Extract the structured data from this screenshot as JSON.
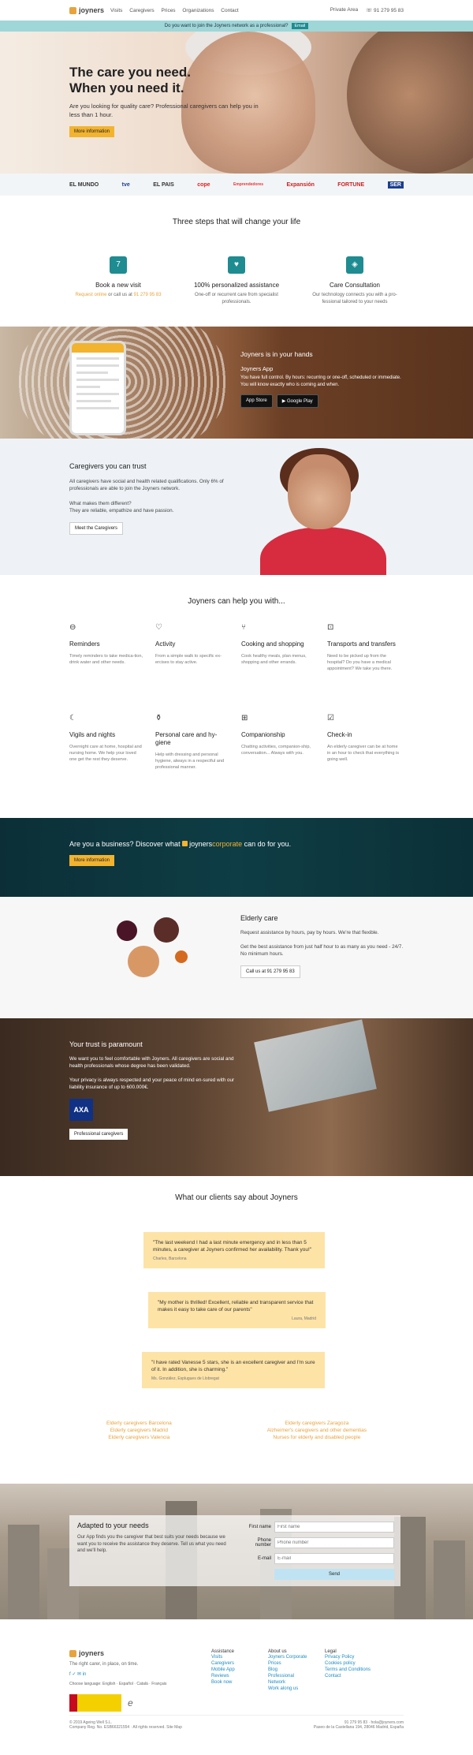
{
  "header": {
    "brand": "joyners",
    "nav": [
      "Visits",
      "Caregivers",
      "Prices",
      "Organizations",
      "Contact"
    ],
    "private": "Private Area",
    "phone": "91 279 95 83"
  },
  "banner": {
    "text": "Do you want to join the Joyners network as a professional?",
    "email": "Email"
  },
  "hero": {
    "title1": "The care you need.",
    "title2": "When you need it.",
    "subtitle": "Are you looking for quality care? Professional caregivers can help you in less than 1 hour.",
    "cta": "More information"
  },
  "press": [
    "EL MUNDO",
    "tve",
    "EL PAIS",
    "cope",
    "Emprendedores",
    "Expansión",
    "FORTUNE",
    "SER"
  ],
  "steps": {
    "title": "Three steps that will change your life",
    "items": [
      {
        "title": "Book a new visit",
        "l1a": "Request online",
        "l1b": " or call us at ",
        "l1c": "91 279 95 83",
        "l2": ""
      },
      {
        "title": "100% personalized assistance",
        "l1a": "",
        "l1b": "One-off or recurrent care from specialist",
        "l1c": "",
        "l2": "professionals."
      },
      {
        "title": "Care Consultation",
        "l1a": "",
        "l1b": "Our technology connects you with a pro-",
        "l1c": "",
        "l2": "fessional tailored to your needs"
      }
    ]
  },
  "app": {
    "title": "Joyners is in your hands",
    "sub": "Joyners App",
    "p1": "You have full control. By hours: recurring or one-off, scheduled or immediate.",
    "p2": "You will know exactly who is coming and when.",
    "appstore": "App Store",
    "gplay": "Google Play"
  },
  "trust": {
    "title": "Caregivers you can trust",
    "p1": "All caregivers have social and health related qualifications. Only 6% of professionals are able to join the Joyners network.",
    "p2": "What makes them different?",
    "p3": "They are reliable, empathize and have passion.",
    "cta": "Meet the Caregivers"
  },
  "help": {
    "title": "Joyners can help you with...",
    "items": [
      {
        "icon": "pill",
        "title": "Reminders",
        "desc": "Timely reminders to take medica-tion, drink water and other needs."
      },
      {
        "icon": "heart",
        "title": "Activity",
        "desc": "From a simple walk to specific ex-ercises to stay active."
      },
      {
        "icon": "cutlery",
        "title": "Cooking and shopping",
        "desc": "Cook healthy meals, plan menus, shopping and other errands."
      },
      {
        "icon": "car",
        "title": "Transports and transfers",
        "desc": "Need to be picked up from the hospital? Do you have a medical appointment? We take you there."
      },
      {
        "icon": "moon",
        "title": "Vigils and nights",
        "desc": "Overnight care at home, hospital and nursing home. We help your loved one get the rest they deserve."
      },
      {
        "icon": "bottle",
        "title": "Personal care and hy-giene",
        "desc": "Help with dressing and personal hygiene, always in a respectful and professional manner."
      },
      {
        "icon": "cards",
        "title": "Companionship",
        "desc": "Chatting activities, companion-ship, conversation... Always with you."
      },
      {
        "icon": "check",
        "title": "Check-in",
        "desc": "An elderly caregiver can be at home in an hour to check that everything is going well."
      }
    ]
  },
  "biz": {
    "pre": "Are you a business? Discover what ",
    "brand1": "joyners",
    "brand2": "corporate",
    "post": " can do for you.",
    "cta": "More information"
  },
  "elderly": {
    "title": "Elderly care",
    "p1": "Request assistance by hours, pay by hours. We're that flexible.",
    "p2": "Get the best assistance from just half hour to as many as you need - 24/7. No minimum hours.",
    "cta": "Call us at 91 279 95 83"
  },
  "paramount": {
    "title": "Your trust is paramount",
    "p1": "We want you to feel comfortable with Joyners. All caregivers are social and health professionals whose degree has been validated.",
    "p2": "Your privacy is always respected and your peace of mind en-sured with our liability insurance of up to 600.000€.",
    "axa": "AXA",
    "cta": "Professional caregivers"
  },
  "testimonials": {
    "title": "What our clients say about Joyners",
    "items": [
      {
        "text": "\"The last weekend I had a last minute emergency and in less than 5 minutes, a caregiver at Joyners confirmed her availability. Thank you!\"",
        "author": "Charles, Barcelona"
      },
      {
        "text": "\"My mother is thrilled! Excellent, reliable and transparent service that makes it easy to take care of our parents\"",
        "author": "Laura, Madrid"
      },
      {
        "text": "\"I have rated Vanesse 5 stars, she is an excellent caregiver and I'm sure of it. In addition, she is charming.\"",
        "author": "Ms. González, Esplugues de Llobregat"
      }
    ]
  },
  "links": {
    "left": [
      "Elderly caregivers Barcelona",
      "Elderly caregivers Madrid",
      "Elderly caregivers Valencia"
    ],
    "right": [
      "Elderly caregivers Zaragoza",
      "Alzheimer's caregivers and other dementias",
      "Nurses for elderly and disabled people"
    ]
  },
  "adapt": {
    "title": "Adapted to your needs",
    "p": "Our App finds you the caregiver that best suits your needs because we want you to receive the assistance they deserve. Tell us what you need and we'll help.",
    "first": "First name",
    "firstPh": "First name",
    "phone": "Phone number",
    "phonePh": "Phone number",
    "email": "E-mail",
    "emailPh": "E-mail",
    "send": "Send"
  },
  "footer": {
    "brand": "joyners",
    "tag": "The right carer, in place, on time.",
    "social": "f ✓ ✉ in",
    "lang": "Choose language: English · Español · Català · Français",
    "cols": [
      {
        "h": "Assistance",
        "links": [
          "Visits",
          "Caregivers",
          "Mobile App",
          "Reviews",
          "Book now"
        ]
      },
      {
        "h": "About us",
        "links": [
          "Joyners Corporate",
          "Prices",
          "Blog",
          "Professional",
          "Network",
          "Work along us"
        ]
      },
      {
        "h": "Legal",
        "links": [
          "Privacy Policy",
          "Cookies policy",
          "Terms and Conditions",
          "Contact"
        ]
      }
    ],
    "phone": "91 279 95 83 · hola@joyners.com",
    "copy": "© 2019 Ageing Well S.L.",
    "reg": "Company Reg. No. ESB66321554 · All rights reserved. Site Map",
    "addr": "Paseo de la Castellana 194, 28046 Madrid, España"
  }
}
